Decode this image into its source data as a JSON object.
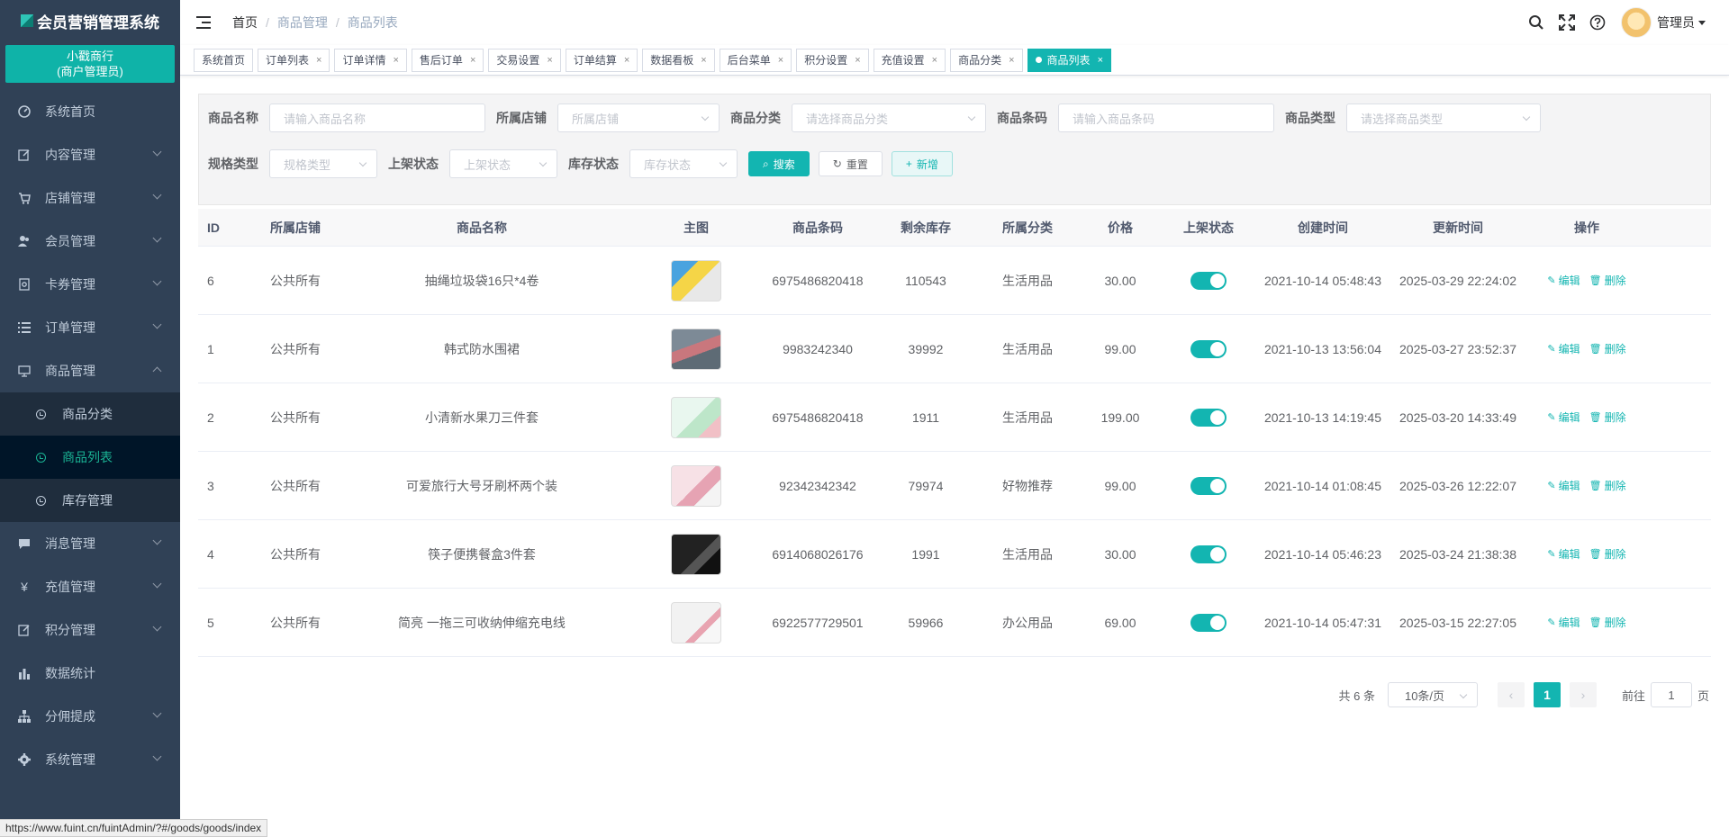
{
  "app": {
    "title": "会员营销管理系统"
  },
  "merchant": {
    "name": "小戳商行",
    "role": "(商户管理员)"
  },
  "sidebar": {
    "items": [
      {
        "label": "系统首页",
        "icon": "dashboard-icon"
      },
      {
        "label": "内容管理",
        "icon": "edit-icon"
      },
      {
        "label": "店铺管理",
        "icon": "cart-icon"
      },
      {
        "label": "会员管理",
        "icon": "users-icon"
      },
      {
        "label": "卡券管理",
        "icon": "ticket-icon"
      },
      {
        "label": "订单管理",
        "icon": "list-icon"
      },
      {
        "label": "商品管理",
        "icon": "monitor-icon"
      },
      {
        "label": "消息管理",
        "icon": "message-icon"
      },
      {
        "label": "充值管理",
        "icon": "yen-icon"
      },
      {
        "label": "积分管理",
        "icon": "edit-icon"
      },
      {
        "label": "数据统计",
        "icon": "chart-icon"
      },
      {
        "label": "分佣提成",
        "icon": "org-icon"
      },
      {
        "label": "系统管理",
        "icon": "gear-icon"
      }
    ],
    "submenu": [
      {
        "label": "商品分类"
      },
      {
        "label": "商品列表"
      },
      {
        "label": "库存管理"
      }
    ]
  },
  "breadcrumb": [
    "首页",
    "商品管理",
    "商品列表"
  ],
  "header": {
    "admin": "管理员"
  },
  "tags": [
    "系统首页",
    "订单列表",
    "订单详情",
    "售后订单",
    "交易设置",
    "订单结算",
    "数据看板",
    "后台菜单",
    "积分设置",
    "充值设置",
    "商品分类",
    "商品列表"
  ],
  "filter": {
    "name_label": "商品名称",
    "name_placeholder": "请输入商品名称",
    "store_label": "所属店铺",
    "store_placeholder": "所属店铺",
    "cate_label": "商品分类",
    "cate_placeholder": "请选择商品分类",
    "code_label": "商品条码",
    "code_placeholder": "请输入商品条码",
    "type_label": "商品类型",
    "type_placeholder": "请选择商品类型",
    "spec_label": "规格类型",
    "spec_placeholder": "规格类型",
    "shelf_label": "上架状态",
    "shelf_placeholder": "上架状态",
    "stock_label": "库存状态",
    "stock_placeholder": "库存状态",
    "search": "搜索",
    "reset": "重置",
    "add": "新增"
  },
  "table": {
    "headers": [
      "ID",
      "所属店铺",
      "商品名称",
      "主图",
      "商品条码",
      "剩余库存",
      "所属分类",
      "价格",
      "上架状态",
      "创建时间",
      "更新时间",
      "操作"
    ],
    "rows": [
      {
        "id": "6",
        "store": "公共所有",
        "name": "抽绳垃圾袋16只*4卷",
        "code": "6975486820418",
        "stock": "110543",
        "category": "生活用品",
        "price": "30.00",
        "on_shelf": true,
        "created": "2021-10-14 05:48:43",
        "updated": "2025-03-29 22:24:02"
      },
      {
        "id": "1",
        "store": "公共所有",
        "name": "韩式防水围裙",
        "code": "9983242340",
        "stock": "39992",
        "category": "生活用品",
        "price": "99.00",
        "on_shelf": true,
        "created": "2021-10-13 13:56:04",
        "updated": "2025-03-27 23:52:37"
      },
      {
        "id": "2",
        "store": "公共所有",
        "name": "小清新水果刀三件套",
        "code": "6975486820418",
        "stock": "1911",
        "category": "生活用品",
        "price": "199.00",
        "on_shelf": true,
        "created": "2021-10-13 14:19:45",
        "updated": "2025-03-20 14:33:49"
      },
      {
        "id": "3",
        "store": "公共所有",
        "name": "可爱旅行大号牙刷杯两个装",
        "code": "92342342342",
        "stock": "79974",
        "category": "好物推荐",
        "price": "99.00",
        "on_shelf": true,
        "created": "2021-10-14 01:08:45",
        "updated": "2025-03-26 12:22:07"
      },
      {
        "id": "4",
        "store": "公共所有",
        "name": "筷子便携餐盒3件套",
        "code": "6914068026176",
        "stock": "1991",
        "category": "生活用品",
        "price": "30.00",
        "on_shelf": true,
        "created": "2021-10-14 05:46:23",
        "updated": "2025-03-24 21:38:38"
      },
      {
        "id": "5",
        "store": "公共所有",
        "name": "简亮 一拖三可收纳伸缩充电线",
        "code": "6922577729501",
        "stock": "59966",
        "category": "办公用品",
        "price": "69.00",
        "on_shelf": true,
        "created": "2021-10-14 05:47:31",
        "updated": "2025-03-15 22:27:05"
      }
    ],
    "edit": "编辑",
    "delete": "删除"
  },
  "pager": {
    "total": "共 6 条",
    "size": "10条/页",
    "page": "1",
    "goto_prefix": "前往",
    "goto_value": "1",
    "goto_suffix": "页"
  },
  "statusbar": {
    "url": "https://www.fuint.cn/fuintAdmin/?#/goods/goods/index"
  },
  "colors": {
    "primary": "#13b5b1",
    "sidebar": "#304156",
    "sidebar_active": "#001528"
  }
}
